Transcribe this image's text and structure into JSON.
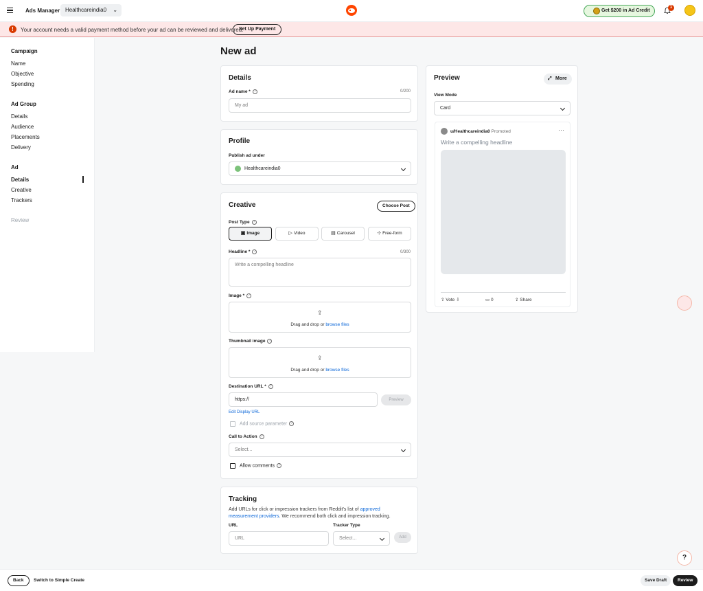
{
  "topbar": {
    "app_title": "Ads Manager",
    "account_name": "Healthcareindia0",
    "credit_label": "Get $200 in Ad Credit",
    "notification_count": "1"
  },
  "banner": {
    "message": "Your account needs a valid payment method before your ad can be reviewed and delivered.",
    "button_label": "Set Up Payment"
  },
  "sidebar": {
    "campaign": {
      "heading": "Campaign",
      "items": [
        "Name",
        "Objective",
        "Spending"
      ]
    },
    "ad_group": {
      "heading": "Ad Group",
      "items": [
        "Details",
        "Audience",
        "Placements",
        "Delivery"
      ]
    },
    "ad": {
      "heading": "Ad",
      "items": [
        "Details",
        "Creative",
        "Trackers"
      ]
    },
    "review": "Review"
  },
  "page_title": "New ad",
  "details": {
    "title": "Details",
    "ad_name_label": "Ad name *",
    "ad_name_counter": "0/200",
    "ad_name_placeholder": "My ad"
  },
  "profile": {
    "title": "Profile",
    "publish_label": "Publish ad under",
    "publish_value": "Healthcareindia0"
  },
  "creative": {
    "title": "Creative",
    "choose_post": "Choose Post",
    "post_type_label": "Post Type",
    "post_types": [
      "Image",
      "Video",
      "Carousel",
      "Free-form"
    ],
    "selected_post_type": "Image",
    "headline_label": "Headline *",
    "headline_counter": "0/300",
    "headline_placeholder": "Write a compelling headline",
    "image_label": "Image *",
    "dropzone_text": "Drag and drop or",
    "dropzone_link": "browse files",
    "thumbnail_label": "Thumbnail image",
    "destination_label": "Destination URL *",
    "destination_value": "https://",
    "preview_button": "Preview",
    "edit_display_url": "Edit Display URL",
    "add_source_param": "Add source parameter",
    "cta_label": "Call to Action",
    "cta_placeholder": "Select...",
    "allow_comments": "Allow comments"
  },
  "tracking": {
    "title": "Tracking",
    "description_pre": "Add URLs for click or impression trackers from Reddit's list of",
    "description_link": "approved measurement providers",
    "description_post": ". We recommend both click and impression tracking.",
    "url_label": "URL",
    "url_placeholder": "URL",
    "tracker_type_label": "Tracker Type",
    "tracker_type_placeholder": "Select...",
    "add_button": "Add"
  },
  "preview": {
    "title": "Preview",
    "more_button": "More",
    "view_mode_label": "View Mode",
    "view_mode_value": "Card",
    "username": "u/Healthcareindia0",
    "promoted": "Promoted",
    "headline": "Write a compelling headline",
    "vote_label": "Vote",
    "comment_count": "0",
    "share_label": "Share"
  },
  "footer": {
    "back": "Back",
    "simple_create": "Switch to Simple Create",
    "save_draft": "Save Draft",
    "review": "Review"
  },
  "help_fab": "?",
  "colors": {
    "accent": "#0a66d8",
    "brand": "#ff4500",
    "success": "#46a758",
    "error": "#d93a00"
  }
}
